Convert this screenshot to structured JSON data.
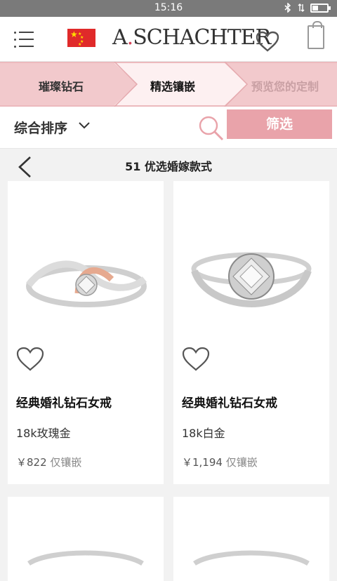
{
  "status": {
    "time": "15:16"
  },
  "header": {
    "logo_text": "A.SCHACHTER",
    "flag_label": "China flag"
  },
  "steps": [
    {
      "label": "璀璨钻石"
    },
    {
      "label": "精选镶嵌"
    },
    {
      "label": "预览您的定制"
    }
  ],
  "sort": {
    "label": "综合排序",
    "filter_label": "筛选"
  },
  "results": {
    "count_text": "51 优选婚嫁款式"
  },
  "products": [
    {
      "name": "经典婚礼钻石女戒",
      "metal": "18k玫瑰金",
      "price": "￥822",
      "price_note": "仅镶嵌"
    },
    {
      "name": "经典婚礼钻石女戒",
      "metal": "18k白金",
      "price": "￥1,194",
      "price_note": "仅镶嵌"
    }
  ],
  "colors": {
    "accent_pink": "#e9a3aa",
    "steps_bg": "#f2c9cc"
  }
}
